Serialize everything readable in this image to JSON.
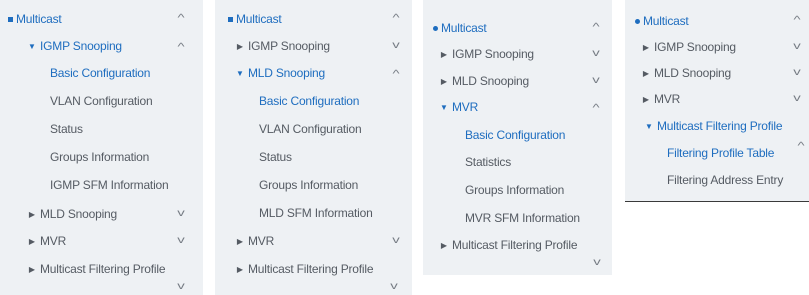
{
  "panels": [
    {
      "multicast": "Multicast",
      "igmp": "IGMP Snooping",
      "basic": "Basic Configuration",
      "vlan": "VLAN Configuration",
      "status": "Status",
      "groups": "Groups Information",
      "sfm": "IGMP SFM Information",
      "mld": "MLD Snooping",
      "mvr": "MVR",
      "filter": "Multicast Filtering Profile"
    },
    {
      "multicast": "Multicast",
      "igmp": "IGMP Snooping",
      "mld": "MLD Snooping",
      "basic": "Basic Configuration",
      "vlan": "VLAN Configuration",
      "status": "Status",
      "groups": "Groups Information",
      "sfm": "MLD SFM Information",
      "mvr": "MVR",
      "filter": "Multicast Filtering Profile"
    },
    {
      "multicast": "Multicast",
      "igmp": "IGMP Snooping",
      "mld": "MLD Snooping",
      "mvr": "MVR",
      "basic": "Basic Configuration",
      "statistics": "Statistics",
      "groups": "Groups Information",
      "sfm": "MVR SFM Information",
      "filter": "Multicast Filtering Profile"
    },
    {
      "multicast": "Multicast",
      "igmp": "IGMP Snooping",
      "mld": "MLD Snooping",
      "mvr": "MVR",
      "filter": "Multicast Filtering Profile",
      "table": "Filtering Profile Table",
      "address": "Filtering Address Entry"
    }
  ],
  "icons": {
    "chevron_up": "chevron-up-icon",
    "chevron_down": "chevron-down-icon",
    "expand_right": "triangle-right-icon",
    "expanded_down": "triangle-down-icon",
    "menu_bullet": "bullet-icon"
  },
  "colors": {
    "panel_bg": "#eef1f4",
    "active_link": "#1e6dbf",
    "text": "#555b63"
  }
}
